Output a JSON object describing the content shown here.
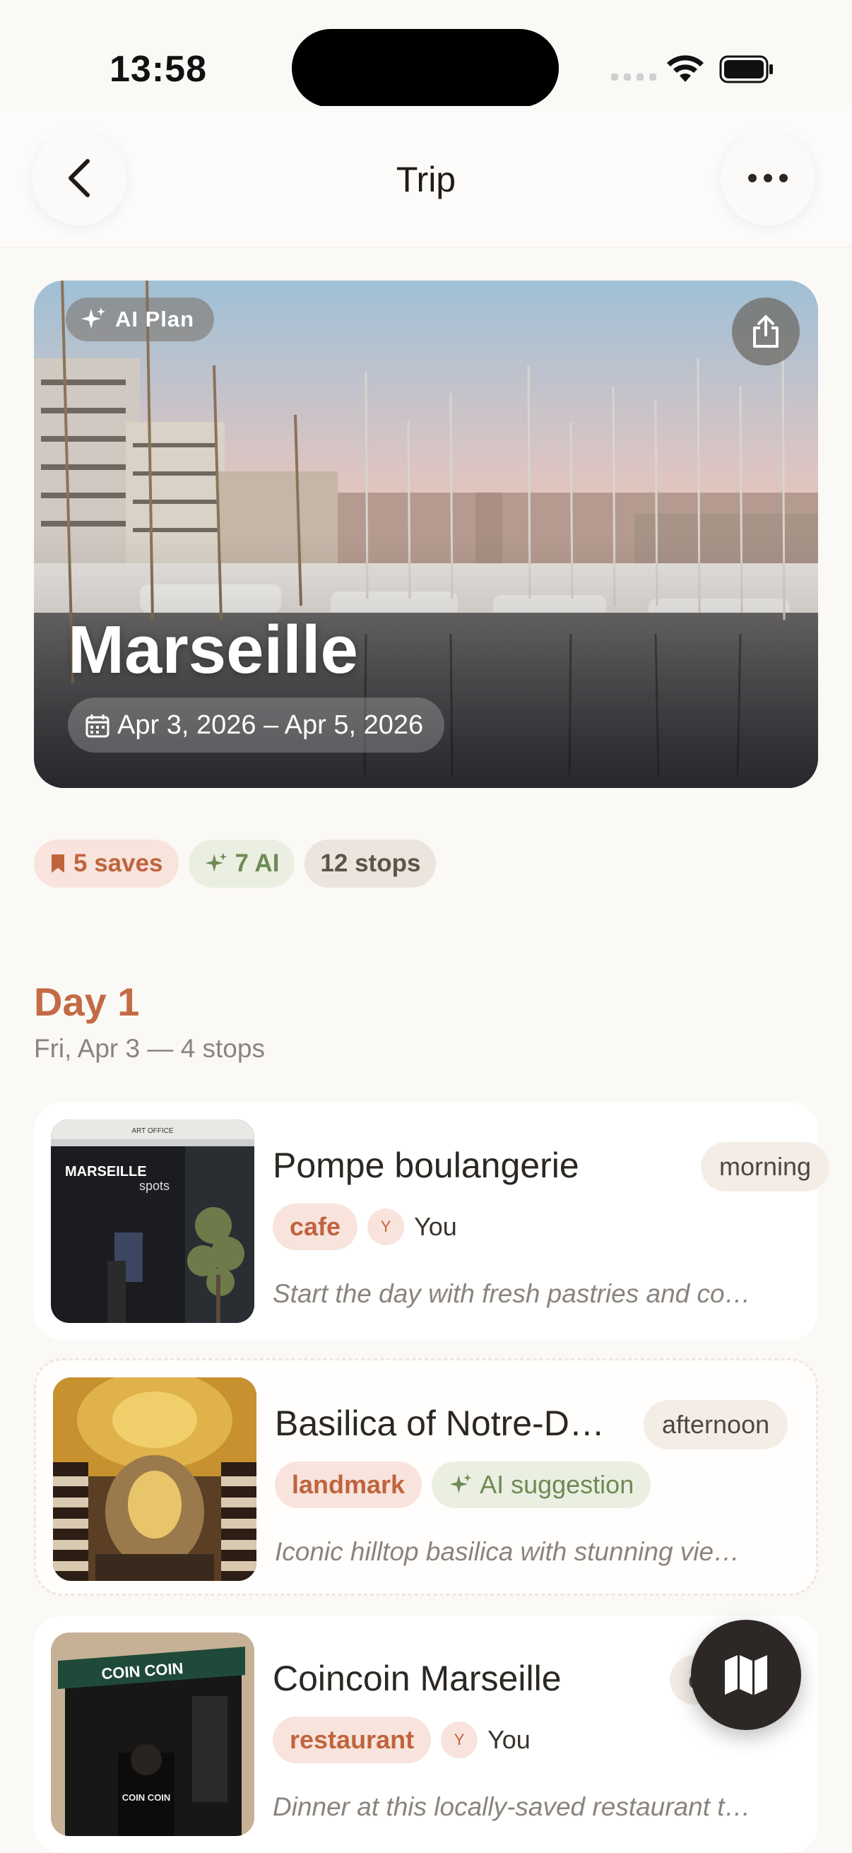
{
  "status_bar": {
    "time": "13:58"
  },
  "header": {
    "title": "Trip"
  },
  "hero": {
    "badge_label": "AI Plan",
    "city": "Marseille",
    "dates": "Apr 3, 2026 – Apr 5, 2026"
  },
  "chips": {
    "saves": "5 saves",
    "ai": "7 AI",
    "stops": "12 stops"
  },
  "day": {
    "title": "Day 1",
    "subtitle": "Fri, Apr 3 — 4 stops"
  },
  "stops": [
    {
      "name": "Pompe boulangerie",
      "time_of_day": "morning",
      "category": "cafe",
      "author_initial": "Y",
      "author": "You",
      "description": "Start the day with fresh pastries and co…",
      "thumb_text": {
        "line1": "ART OFFICE",
        "line2": "MARSEILLE",
        "line3": "spots"
      }
    },
    {
      "name": "Basilica of Notre-D…",
      "time_of_day": "afternoon",
      "category": "landmark",
      "ai_label": "AI suggestion",
      "description": "Iconic hilltop basilica with stunning vie…"
    },
    {
      "name": "Coincoin Marseille",
      "time_of_day": "e",
      "category": "restaurant",
      "author_initial": "Y",
      "author": "You",
      "description": "Dinner at this locally-saved restaurant t…",
      "thumb_text": {
        "awning": "COIN COIN",
        "shirt": "COIN COIN"
      }
    }
  ],
  "colors": {
    "accent": "#c26b45",
    "ai_green": "#6f8a55",
    "background": "#fbf9f6"
  }
}
